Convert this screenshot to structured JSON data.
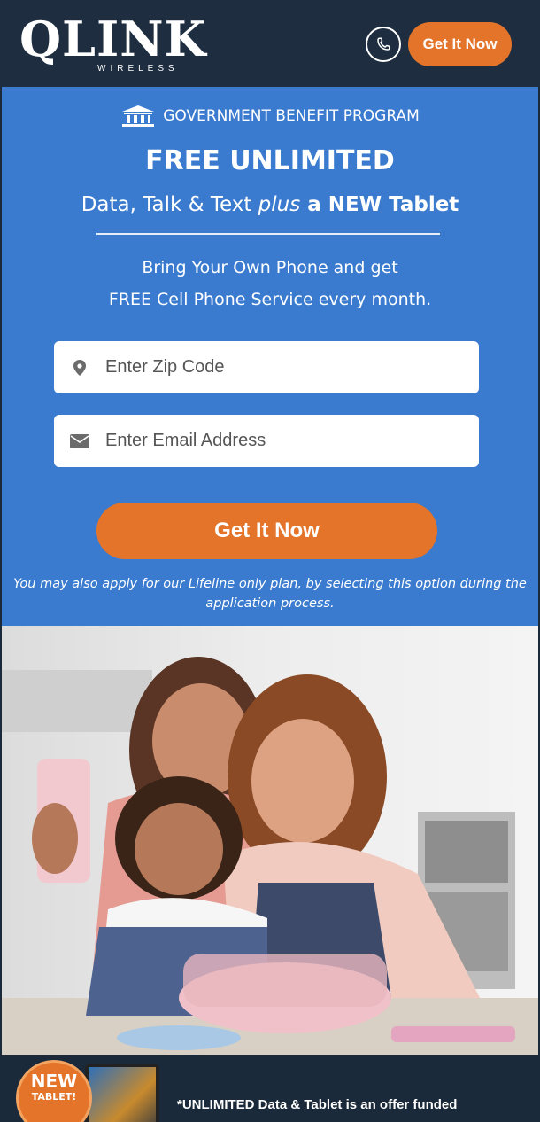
{
  "header": {
    "logo_text": "QLINK",
    "logo_subtext": "WIRELESS",
    "phone_icon": "phone-icon",
    "cta_label": "Get It Now"
  },
  "hero": {
    "badge_icon": "bank-building-icon",
    "badge_text": "GOVERNMENT BENEFIT PROGRAM",
    "headline": "FREE UNLIMITED",
    "subhead_part1": "Data, Talk & Text ",
    "subhead_plus": "plus",
    "subhead_part2": " a NEW Tablet",
    "body_line1": "Bring Your Own Phone and get",
    "body_line2": "FREE Cell Phone Service every month.",
    "zip_placeholder": "Enter Zip Code",
    "zip_icon": "map-marker-icon",
    "email_placeholder": "Enter Email Address",
    "email_icon": "envelope-icon",
    "cta_label": "Get It Now",
    "disclaimer_line1": "You may also apply for our Lifeline only plan, by selecting this option during the",
    "disclaimer_line2": "application process."
  },
  "footer": {
    "badge_line1": "NEW",
    "badge_line2": "TABLET!",
    "text": "*UNLIMITED Data & Tablet is an offer funded"
  },
  "colors": {
    "header_bg": "#1e2e40",
    "hero_bg": "#3a7bcf",
    "accent_orange": "#e3742a",
    "footer_bg": "#1b2a3a"
  }
}
